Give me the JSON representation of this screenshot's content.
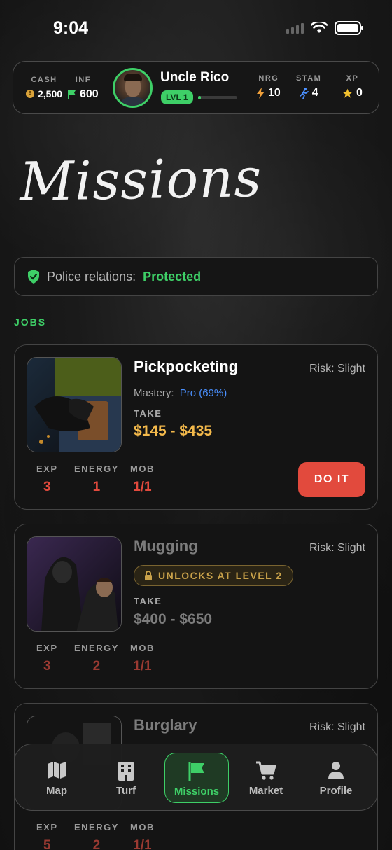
{
  "status": {
    "time": "9:04"
  },
  "header": {
    "cash_label": "CASH",
    "cash_value": "2,500",
    "inf_label": "INF",
    "inf_value": "600",
    "player_name": "Uncle Rico",
    "level": "LVL 1",
    "xp_progress": 0.08,
    "nrg_label": "NRG",
    "nrg_value": "10",
    "stam_label": "STAM",
    "stam_value": "4",
    "xp_label": "XP",
    "xp_value": "0"
  },
  "page": {
    "title": "Missions"
  },
  "police": {
    "label": "Police relations:",
    "value": "Protected"
  },
  "jobs_section": {
    "label": "JOBS"
  },
  "jobs": [
    {
      "name": "Pickpocketing",
      "risk": "Risk: Slight",
      "mastery_label": "Mastery:",
      "mastery_value": "Pro (69%)",
      "take_label": "TAKE",
      "take": "$145 - $435",
      "exp_label": "EXP",
      "exp": "3",
      "energy_label": "ENERGY",
      "energy": "1",
      "mob_label": "MOB",
      "mob": "1/1",
      "action": "DO IT"
    },
    {
      "name": "Mugging",
      "risk": "Risk: Slight",
      "unlock": "UNLOCKS AT LEVEL 2",
      "take_label": "TAKE",
      "take": "$400 - $650",
      "exp_label": "EXP",
      "exp": "3",
      "energy_label": "ENERGY",
      "energy": "2",
      "mob_label": "MOB",
      "mob": "1/1"
    },
    {
      "name": "Burglary",
      "risk": "Risk: Slight",
      "exp_label": "EXP",
      "exp": "5",
      "energy_label": "ENERGY",
      "energy": "2",
      "mob_label": "MOB",
      "mob": "1/1"
    }
  ],
  "nav": [
    {
      "label": "Map",
      "icon": "map-icon"
    },
    {
      "label": "Turf",
      "icon": "building-icon"
    },
    {
      "label": "Missions",
      "icon": "flag-icon"
    },
    {
      "label": "Market",
      "icon": "cart-icon"
    },
    {
      "label": "Profile",
      "icon": "user-icon"
    }
  ],
  "colors": {
    "accent": "#3ecf67",
    "danger": "#e24a3d",
    "gold": "#f3b94b",
    "mastery": "#4a90ff"
  }
}
